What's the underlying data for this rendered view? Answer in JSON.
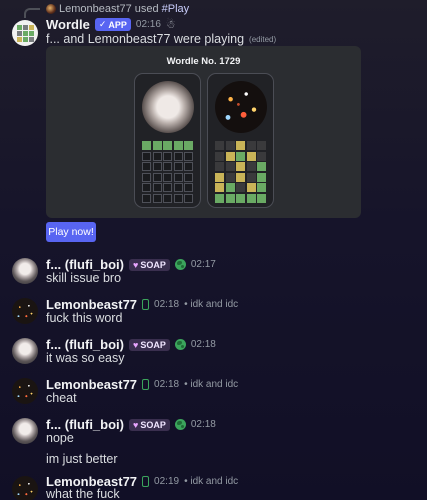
{
  "reply": {
    "user": "Lemonbeast77",
    "used": "used",
    "command_prefix": "#",
    "command": "Play"
  },
  "wordle_post": {
    "author": "Wordle",
    "badge": "APP",
    "time": "02:16",
    "text": "f... and Lemonbeast77 were playing",
    "edited": "(edited)",
    "card_title": "Wordle No. 1729",
    "play_button": "Play now!",
    "boards": [
      {
        "player": "f...",
        "rows": [
          [
            "g",
            "g",
            "g",
            "g",
            "g"
          ],
          [
            "e",
            "e",
            "e",
            "e",
            "e"
          ],
          [
            "e",
            "e",
            "e",
            "e",
            "e"
          ],
          [
            "e",
            "e",
            "e",
            "e",
            "e"
          ],
          [
            "e",
            "e",
            "e",
            "e",
            "e"
          ],
          [
            "e",
            "e",
            "e",
            "e",
            "e"
          ]
        ]
      },
      {
        "player": "Lemonbeast77",
        "rows": [
          [
            "x",
            "x",
            "y",
            "x",
            "x"
          ],
          [
            "x",
            "y",
            "g",
            "y",
            "x"
          ],
          [
            "x",
            "x",
            "y",
            "x",
            "g"
          ],
          [
            "y",
            "x",
            "y",
            "x",
            "g"
          ],
          [
            "y",
            "g",
            "x",
            "y",
            "g"
          ],
          [
            "g",
            "g",
            "g",
            "g",
            "g"
          ]
        ]
      }
    ]
  },
  "messages": [
    {
      "author": "f... (flufi_boi)",
      "tag": "SOAP",
      "time": "02:17",
      "text": "skill issue bro"
    },
    {
      "author": "Lemonbeast77",
      "time": "02:18",
      "status": "• idk and idc",
      "text": "fuck this word"
    },
    {
      "author": "f... (flufi_boi)",
      "tag": "SOAP",
      "time": "02:18",
      "text": "it was so easy"
    },
    {
      "author": "Lemonbeast77",
      "time": "02:18",
      "status": "• idk and idc",
      "text": "cheat"
    },
    {
      "author": "f... (flufi_boi)",
      "tag": "SOAP",
      "time": "02:18",
      "text": "nope",
      "text2": "im just better"
    },
    {
      "author": "Lemonbeast77",
      "time": "02:19",
      "status": "• idk and idc",
      "text": "what the fuck"
    }
  ],
  "colors": {
    "accent": "#5865f2",
    "wordle_green": "#6aaa64",
    "wordle_yellow": "#c9b458",
    "online_green": "#3ba55c"
  }
}
